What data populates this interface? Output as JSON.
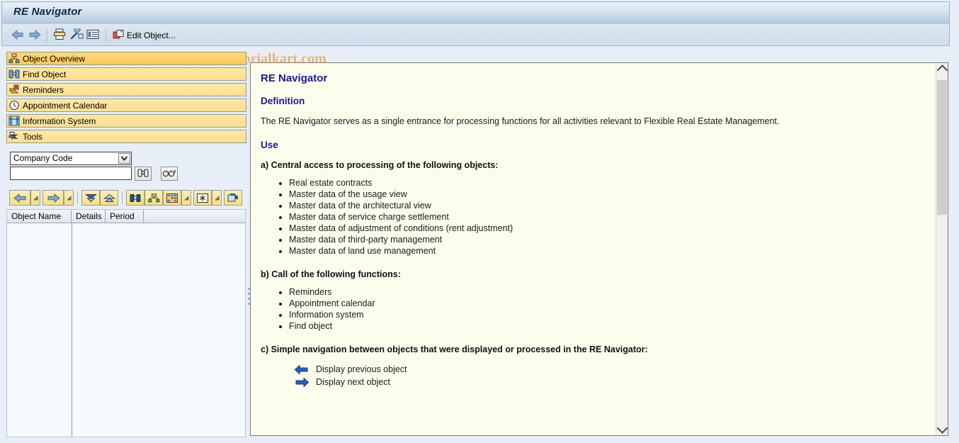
{
  "window": {
    "title": "RE Navigator",
    "watermark": "© www.tutorialkart.com"
  },
  "toolbar": {
    "back_icon": "back-arrow-icon",
    "forward_icon": "forward-arrow-icon",
    "print_icon": "print-icon",
    "settings_icon": "wrench-icon",
    "layout_icon": "list-layout-icon",
    "edit_object_label": "Edit Object...",
    "edit_object_icon": "edit-object-icon"
  },
  "sidebar": {
    "items": [
      {
        "label": "Object Overview",
        "icon": "object-overview-icon",
        "selected": true
      },
      {
        "label": "Find Object",
        "icon": "binoculars-icon",
        "selected": false
      },
      {
        "label": "Reminders",
        "icon": "reminders-icon",
        "selected": false
      },
      {
        "label": "Appointment Calendar",
        "icon": "clock-icon",
        "selected": false
      },
      {
        "label": "Information System",
        "icon": "info-system-icon",
        "selected": false
      },
      {
        "label": "Tools",
        "icon": "tools-icon",
        "selected": false
      }
    ]
  },
  "search": {
    "object_type_value": "Company Code",
    "object_type_options": [
      "Company Code"
    ],
    "value": "",
    "placeholder": "",
    "find_icon": "binoculars-icon",
    "glasses_icon": "glasses-icon",
    "dropdown_icon": "chevron-down-icon"
  },
  "nav_toolbar": {
    "buttons": [
      {
        "icon": "previous-object-icon",
        "has_menu": true
      },
      {
        "icon": "next-object-icon",
        "has_menu": true
      },
      {
        "icon": "expand-all-icon",
        "has_menu": false
      },
      {
        "icon": "collapse-all-icon",
        "has_menu": false
      },
      {
        "icon": "find-icon",
        "has_menu": false
      },
      {
        "icon": "hierarchy-icon",
        "has_menu": false
      },
      {
        "icon": "table-layout-icon",
        "has_menu": true
      },
      {
        "icon": "select-layout-icon",
        "has_menu": true
      },
      {
        "icon": "refresh-icon",
        "has_menu": false
      }
    ]
  },
  "table": {
    "columns": [
      "Object Name",
      "Details",
      "Period"
    ],
    "rows": []
  },
  "document": {
    "title": "RE Navigator",
    "definition_heading": "Definition",
    "definition_text": "The RE Navigator serves as a single entrance for processing functions for all activities relevant to Flexible Real Estate Management.",
    "use_heading": "Use",
    "section_a": "a) Central access to processing of the following objects:",
    "list_a": [
      "Real estate contracts",
      "Master data of the usage view",
      "Master data of the architectural view",
      "Master data of service charge settlement",
      "Master data of adjustment of conditions (rent adjustment)",
      "Master data of third-party management",
      "Master data of land use management"
    ],
    "section_b": "b) Call of the following functions:",
    "list_b": [
      "Reminders",
      "Appointment calendar",
      "Information system",
      "Find object"
    ],
    "section_c": "c) Simple navigation between objects that were displayed or processed in the RE Navigator:",
    "nav_lines": [
      {
        "icon": "previous-object-icon",
        "text": "Display previous object"
      },
      {
        "icon": "next-object-icon",
        "text": "Display next object"
      }
    ]
  },
  "scrollbar": {
    "up_icon": "chevron-up-icon",
    "down_icon": "chevron-down-icon"
  },
  "colors": {
    "accent": "#1a1a8c",
    "nav_button": "#fde39b",
    "nav_button_selected": "#ffd06a",
    "doc_background": "#fdfdee",
    "watermark": "#e8b281"
  }
}
